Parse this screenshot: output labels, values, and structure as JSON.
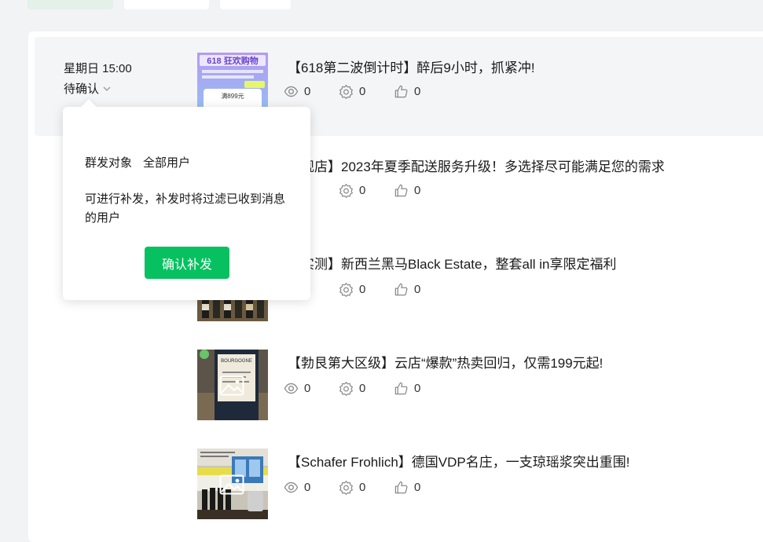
{
  "top_tabs": [
    "",
    "",
    ""
  ],
  "rows": [
    {
      "time": "星期日 15:00",
      "status": "待确认",
      "title": "【618第二波倒计时】醉后9小时，抓紧冲!",
      "views": "0",
      "shares": "0",
      "likes": "0",
      "thumb_text": "618 狂欢购物",
      "thumb_badge": "满899元"
    },
    {
      "title": "旗舰店】2023年夏季配送服务升级！多选择尽可能满足您的需求",
      "views": "0",
      "shares": "0",
      "likes": "0"
    },
    {
      "title": "鉴实测】新西兰黑马Black Estate，整套all in享限定福利",
      "views": "0",
      "shares": "0",
      "likes": "0"
    },
    {
      "title": "【勃艮第大区级】云店“爆款”热卖回归，仅需199元起!",
      "views": "0",
      "shares": "0",
      "likes": "0",
      "thumb_text": "BOURGOGNE"
    },
    {
      "title": "【Schafer Frohlich】德国VDP名庄，一支琼瑶浆突出重围!",
      "views": "0",
      "shares": "0",
      "likes": "0"
    }
  ],
  "popover": {
    "target_label": "群发对象",
    "target_value": "全部用户",
    "description": "可进行补发，补发时将过滤已收到消息的用户",
    "confirm_button": "确认补发"
  },
  "colors": {
    "accent": "#07c160",
    "page_bg": "#f2f3f5",
    "row_highlight": "#f4f5f7",
    "active_tab": "#e3f1e8"
  },
  "icons": {
    "views": "eye-icon",
    "shares": "share-gear-icon",
    "likes": "thumbs-up-icon",
    "status": "chevron-down-icon",
    "image": "image-placeholder-icon"
  }
}
